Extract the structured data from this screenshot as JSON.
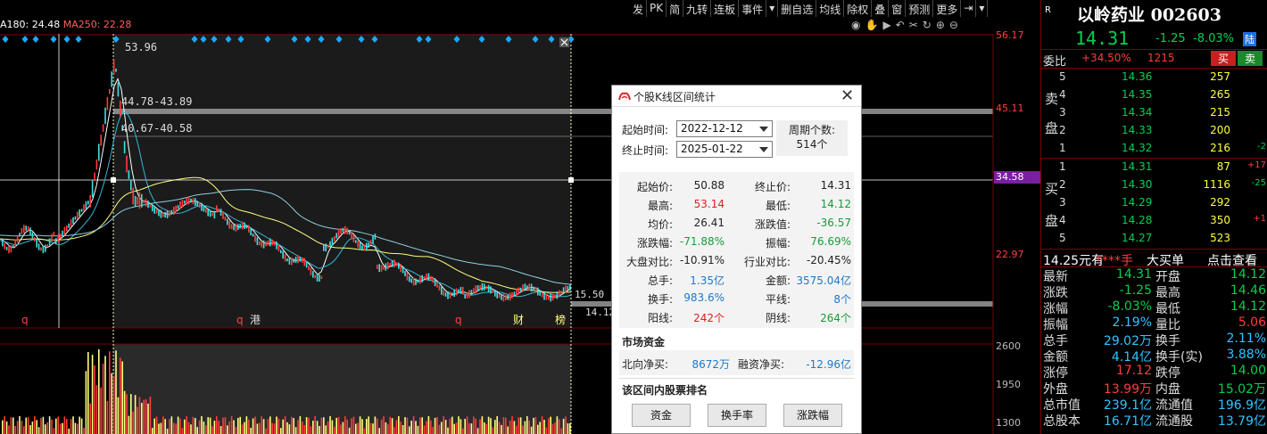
{
  "toolbar": [
    "发",
    "PK",
    "简",
    "九转",
    "连板",
    "事件",
    "▾",
    "删自选",
    "均线",
    "除权",
    "叠",
    "窗",
    "预测",
    "更多",
    "⇥",
    "▾"
  ],
  "ma_line": {
    "ma180": "A180: 24.48",
    "ma250": "MA250: 22.28"
  },
  "chart": {
    "annotations": [
      "53.96",
      "44.78-43.89",
      "40.67-40.58",
      "15.50",
      "14.12"
    ],
    "bottom_markers": [
      "q",
      "q",
      "港",
      "q",
      "财",
      "榜"
    ],
    "price_axis": [
      "56.17",
      "45.11",
      "34.58",
      "22.97"
    ],
    "volume_axis": [
      "2600",
      "1950",
      "1300"
    ],
    "colors": {
      "up": "#ff3c3c",
      "down": "#3ce0e0",
      "ma_yellow": "#ffff80",
      "ma_cyan": "#33b8d8",
      "marker_blue": "#1ea7ff"
    }
  },
  "stock": {
    "badge": "R",
    "name_code": "以岭药业 002603",
    "price": "14.31",
    "change": "-1.25",
    "pct": "-8.03%",
    "market_badge": "陆",
    "weibi_label": "委比",
    "weibi_value": "+34.50%",
    "weibi_qty": "1215",
    "buy_btn": "买",
    "sell_btn": "卖",
    "sell_side_label": [
      "卖",
      "盘"
    ],
    "buy_side_label": [
      "买",
      "盘"
    ],
    "asks": [
      {
        "n": "5",
        "price": "14.36",
        "vol": "257",
        "chg": ""
      },
      {
        "n": "4",
        "price": "14.35",
        "vol": "265",
        "chg": ""
      },
      {
        "n": "3",
        "price": "14.34",
        "vol": "215",
        "chg": ""
      },
      {
        "n": "2",
        "price": "14.33",
        "vol": "200",
        "chg": ""
      },
      {
        "n": "1",
        "price": "14.32",
        "vol": "216",
        "chg": "-2"
      }
    ],
    "bids": [
      {
        "n": "1",
        "price": "14.31",
        "vol": "87",
        "chg": "+17"
      },
      {
        "n": "2",
        "price": "14.30",
        "vol": "1116",
        "chg": "-25"
      },
      {
        "n": "3",
        "price": "14.29",
        "vol": "292",
        "chg": ""
      },
      {
        "n": "4",
        "price": "14.28",
        "vol": "350",
        "chg": "+1"
      },
      {
        "n": "5",
        "price": "14.27",
        "vol": "523",
        "chg": ""
      }
    ],
    "big_order": {
      "price": "14.25元有",
      "stars": "****手",
      "label": "大买单",
      "link": "点击查看"
    },
    "quotes": [
      {
        "l1": "最新",
        "v1": "14.31",
        "c1": "green",
        "l2": "开盘",
        "v2": "14.12",
        "c2": "green"
      },
      {
        "l1": "涨跌",
        "v1": "-1.25",
        "c1": "green",
        "l2": "最高",
        "v2": "14.46",
        "c2": "green"
      },
      {
        "l1": "涨幅",
        "v1": "-8.03%",
        "c1": "green",
        "l2": "最低",
        "v2": "14.12",
        "c2": "green"
      },
      {
        "l1": "振幅",
        "v1": "2.19%",
        "c1": "cyan",
        "l2": "量比",
        "v2": "5.06",
        "c2": "red"
      },
      {
        "l1": "总手",
        "v1": "29.02万",
        "c1": "cyan",
        "l2": "换手",
        "v2": "2.11%",
        "c2": "cyan"
      },
      {
        "l1": "金额",
        "v1": "4.14亿",
        "c1": "cyan",
        "l2": "换手(实)",
        "v2": "3.88%",
        "c2": "cyan"
      },
      {
        "l1": "涨停",
        "v1": "17.12",
        "c1": "red",
        "l2": "跌停",
        "v2": "14.00",
        "c2": "green"
      },
      {
        "l1": "外盘",
        "v1": "13.99万",
        "c1": "red",
        "l2": "内盘",
        "v2": "15.02万",
        "c2": "green"
      },
      {
        "l1": "总市值",
        "v1": "239.1亿",
        "c1": "cyan",
        "l2": "流通值",
        "v2": "196.9亿",
        "c2": "cyan"
      },
      {
        "l1": "总股本",
        "v1": "16.71亿",
        "c1": "cyan",
        "l2": "流通股",
        "v2": "13.79亿",
        "c2": "cyan"
      }
    ]
  },
  "dialog": {
    "title": "个股K线区间统计",
    "start_label": "起始时间:",
    "start_value": "2022-12-12",
    "end_label": "终止时间:",
    "end_value": "2025-01-22",
    "count_label": "周期个数:",
    "count_value": "514个",
    "stats": [
      {
        "l1": "起始价:",
        "v1": "50.88",
        "c1": "",
        "l2": "终止价:",
        "v2": "14.31",
        "c2": ""
      },
      {
        "l1": "最高:",
        "v1": "53.14",
        "c1": "dred",
        "l2": "最低:",
        "v2": "14.12",
        "c2": "dgreen"
      },
      {
        "l1": "均价:",
        "v1": "26.41",
        "c1": "",
        "l2": "涨跌值:",
        "v2": "-36.57",
        "c2": "dgreen"
      },
      {
        "l1": "涨跌幅:",
        "v1": "-71.88%",
        "c1": "dgreen",
        "l2": "振幅:",
        "v2": "76.69%",
        "c2": "dgreen"
      },
      {
        "l1": "大盘对比:",
        "v1": "-10.91%",
        "c1": "",
        "l2": "行业对比:",
        "v2": "-20.45%",
        "c2": ""
      },
      {
        "l1": "总手:",
        "v1": "1.35亿",
        "c1": "dblue",
        "l2": "金额:",
        "v2": "3575.04亿",
        "c2": "dblue"
      },
      {
        "l1": "换手:",
        "v1": "983.6%",
        "c1": "dblue",
        "l2": "平线:",
        "v2": "8个",
        "c2": "dblue"
      },
      {
        "l1": "阳线:",
        "v1": "242个",
        "c1": "dred",
        "l2": "阴线:",
        "v2": "264个",
        "c2": "dgreen"
      }
    ],
    "market_funds_title": "市场资金",
    "north_label": "北向净买:",
    "north_value": "8672万",
    "margin_label": "融资净买:",
    "margin_value": "-12.96亿",
    "ranking_title": "该区间内股票排名",
    "buttons": [
      "资金",
      "换手率",
      "涨跌幅"
    ]
  }
}
